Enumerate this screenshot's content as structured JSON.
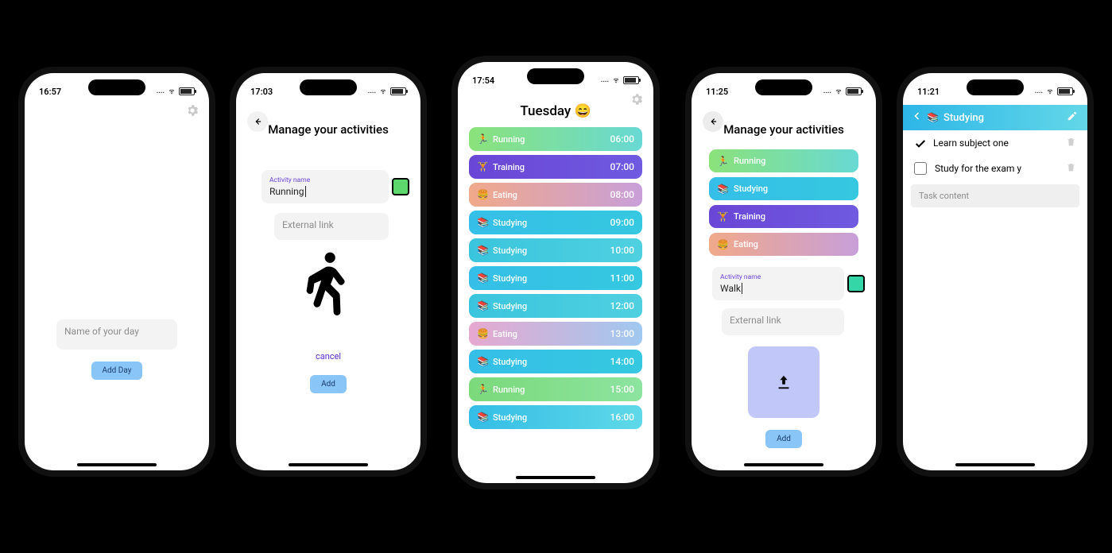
{
  "screen1": {
    "time": "16:57",
    "placeholder_dayname": "Name of your day",
    "add_day_btn": "Add Day"
  },
  "screen2": {
    "time": "17:03",
    "title": "Manage your activities",
    "activity_label": "Activity name",
    "activity_value": "Running",
    "external_link_placeholder": "External link",
    "cancel": "cancel",
    "add_btn": "Add",
    "color": "#5cd86c"
  },
  "screen3": {
    "time": "17:54",
    "day_title": "Tuesday 😄",
    "rows": [
      {
        "icon": "🏃",
        "name": "Running",
        "time": "06:00",
        "grad": "g-green"
      },
      {
        "icon": "🏋️",
        "name": "Training",
        "time": "07:00",
        "grad": "g-purple"
      },
      {
        "icon": "🍔",
        "name": "Eating",
        "time": "08:00",
        "grad": "g-peach"
      },
      {
        "icon": "📚",
        "name": "Studying",
        "time": "09:00",
        "grad": "g-cyan"
      },
      {
        "icon": "📚",
        "name": "Studying",
        "time": "10:00",
        "grad": "g-cyan2"
      },
      {
        "icon": "📚",
        "name": "Studying",
        "time": "11:00",
        "grad": "g-cyan"
      },
      {
        "icon": "📚",
        "name": "Studying",
        "time": "12:00",
        "grad": "g-cyan2"
      },
      {
        "icon": "🍔",
        "name": "Eating",
        "time": "13:00",
        "grad": "g-pink"
      },
      {
        "icon": "📚",
        "name": "Studying",
        "time": "14:00",
        "grad": "g-cyan"
      },
      {
        "icon": "🏃",
        "name": "Running",
        "time": "15:00",
        "grad": "g-green2"
      },
      {
        "icon": "📚",
        "name": "Studying",
        "time": "16:00",
        "grad": "g-cyan3"
      }
    ]
  },
  "screen4": {
    "time": "11:25",
    "title": "Manage your activities",
    "chips": [
      {
        "icon": "🏃",
        "label": "Running",
        "grad": "g-green"
      },
      {
        "icon": "📚",
        "label": "Studying",
        "grad": "g-cyan"
      },
      {
        "icon": "🏋️",
        "label": "Training",
        "grad": "g-purple"
      },
      {
        "icon": "🍔",
        "label": "Eating",
        "grad": "g-peach"
      }
    ],
    "activity_label": "Activity name",
    "activity_value": "Walk",
    "external_link_placeholder": "External link",
    "add_btn": "Add",
    "color": "#34d6a7"
  },
  "screen5": {
    "time": "11:21",
    "header_icon": "📚",
    "header_title": "Studying",
    "todos": [
      {
        "done": true,
        "text": "Learn subject one"
      },
      {
        "done": false,
        "text": "Study for the exam y"
      }
    ],
    "task_placeholder": "Task content"
  }
}
